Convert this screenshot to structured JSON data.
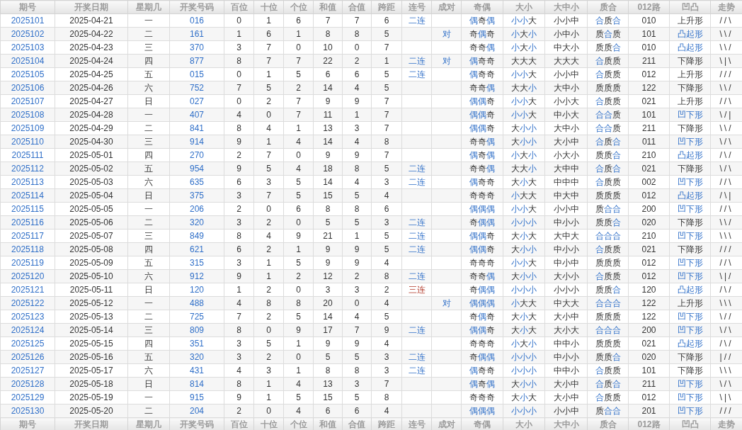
{
  "table": {
    "columns": [
      "期号",
      "开奖日期",
      "星期几",
      "开奖号码",
      "百位",
      "十位",
      "个位",
      "和值",
      "合值",
      "跨距",
      "连号",
      "成对",
      "奇偶",
      "大小",
      "大中小",
      "质合",
      "012路",
      "凹凸",
      "走势"
    ],
    "rows": [
      {
        "issue": "2025101",
        "date": "2025-04-21",
        "weekday": "一",
        "number": "016",
        "hundreds": "0",
        "tens": "1",
        "ones": "6",
        "sum": "7",
        "sum_tail": "7",
        "spread": "6",
        "consecutive": {
          "text": "二连",
          "kind": "double"
        },
        "odd_even": {
          "text": "偶奇偶",
          "highlight": [
            true,
            false,
            true
          ]
        },
        "big_small": {
          "text": "小小大",
          "highlight": [
            true,
            true,
            false
          ]
        },
        "size3": "小小中",
        "prime": {
          "text": "合质合",
          "highlight": [
            true,
            false,
            true
          ]
        },
        "route": "010",
        "shape": {
          "text": "上升形",
          "highlight": false
        },
        "trend": "//\\"
      },
      {
        "issue": "2025102",
        "date": "2025-04-22",
        "weekday": "二",
        "number": "161",
        "hundreds": "1",
        "tens": "6",
        "ones": "1",
        "sum": "8",
        "sum_tail": "8",
        "spread": "5",
        "pair": "对",
        "odd_even": {
          "text": "奇偶奇",
          "highlight": [
            false,
            true,
            false
          ]
        },
        "big_small": {
          "text": "小大小",
          "highlight": [
            true,
            false,
            true
          ]
        },
        "size3": "小中小",
        "prime": {
          "text": "质合质",
          "highlight": [
            false,
            true,
            false
          ]
        },
        "route": "101",
        "shape": {
          "text": "凸起形",
          "highlight": true
        },
        "trend": "\\\\/"
      },
      {
        "issue": "2025103",
        "date": "2025-04-23",
        "weekday": "三",
        "number": "370",
        "hundreds": "3",
        "tens": "7",
        "ones": "0",
        "sum": "10",
        "sum_tail": "0",
        "spread": "7",
        "odd_even": {
          "text": "奇奇偶",
          "highlight": [
            false,
            false,
            true
          ]
        },
        "big_small": {
          "text": "小大小",
          "highlight": [
            true,
            false,
            true
          ]
        },
        "size3": "中大小",
        "prime": {
          "text": "质质合",
          "highlight": [
            false,
            false,
            true
          ]
        },
        "route": "010",
        "shape": {
          "text": "凸起形",
          "highlight": true
        },
        "trend": "\\\\/"
      },
      {
        "issue": "2025104",
        "date": "2025-04-24",
        "weekday": "四",
        "number": "877",
        "hundreds": "8",
        "tens": "7",
        "ones": "7",
        "sum": "22",
        "sum_tail": "2",
        "spread": "1",
        "consecutive": {
          "text": "二连",
          "kind": "double"
        },
        "pair": "对",
        "odd_even": {
          "text": "偶奇奇",
          "highlight": [
            true,
            false,
            false
          ]
        },
        "big_small": {
          "text": "大大大",
          "highlight": [
            false,
            false,
            false
          ]
        },
        "size3": "大大大",
        "prime": {
          "text": "合质质",
          "highlight": [
            true,
            false,
            false
          ]
        },
        "route": "211",
        "shape": {
          "text": "下降形",
          "highlight": false
        },
        "trend": "\\|\\"
      },
      {
        "issue": "2025105",
        "date": "2025-04-25",
        "weekday": "五",
        "number": "015",
        "hundreds": "0",
        "tens": "1",
        "ones": "5",
        "sum": "6",
        "sum_tail": "6",
        "spread": "5",
        "consecutive": {
          "text": "二连",
          "kind": "double"
        },
        "odd_even": {
          "text": "偶奇奇",
          "highlight": [
            true,
            false,
            false
          ]
        },
        "big_small": {
          "text": "小小大",
          "highlight": [
            true,
            true,
            false
          ]
        },
        "size3": "小小中",
        "prime": {
          "text": "合质质",
          "highlight": [
            true,
            false,
            false
          ]
        },
        "route": "012",
        "shape": {
          "text": "上升形",
          "highlight": false
        },
        "trend": "///"
      },
      {
        "issue": "2025106",
        "date": "2025-04-26",
        "weekday": "六",
        "number": "752",
        "hundreds": "7",
        "tens": "5",
        "ones": "2",
        "sum": "14",
        "sum_tail": "4",
        "spread": "5",
        "odd_even": {
          "text": "奇奇偶",
          "highlight": [
            false,
            false,
            true
          ]
        },
        "big_small": {
          "text": "大大小",
          "highlight": [
            false,
            false,
            true
          ]
        },
        "size3": "大中小",
        "prime": {
          "text": "质质质",
          "highlight": [
            false,
            false,
            false
          ]
        },
        "route": "122",
        "shape": {
          "text": "下降形",
          "highlight": false
        },
        "trend": "\\\\/"
      },
      {
        "issue": "2025107",
        "date": "2025-04-27",
        "weekday": "日",
        "number": "027",
        "hundreds": "0",
        "tens": "2",
        "ones": "7",
        "sum": "9",
        "sum_tail": "9",
        "spread": "7",
        "odd_even": {
          "text": "偶偶奇",
          "highlight": [
            true,
            true,
            false
          ]
        },
        "big_small": {
          "text": "小小大",
          "highlight": [
            true,
            true,
            false
          ]
        },
        "size3": "小小大",
        "prime": {
          "text": "合质质",
          "highlight": [
            true,
            false,
            false
          ]
        },
        "route": "021",
        "shape": {
          "text": "上升形",
          "highlight": false
        },
        "trend": "//\\"
      },
      {
        "issue": "2025108",
        "date": "2025-04-28",
        "weekday": "一",
        "number": "407",
        "hundreds": "4",
        "tens": "0",
        "ones": "7",
        "sum": "11",
        "sum_tail": "1",
        "spread": "7",
        "odd_even": {
          "text": "偶偶奇",
          "highlight": [
            true,
            true,
            false
          ]
        },
        "big_small": {
          "text": "小小大",
          "highlight": [
            true,
            true,
            false
          ]
        },
        "size3": "中小大",
        "prime": {
          "text": "合合质",
          "highlight": [
            true,
            true,
            false
          ]
        },
        "route": "101",
        "shape": {
          "text": "凹下形",
          "highlight": true
        },
        "trend": "\\/|"
      },
      {
        "issue": "2025109",
        "date": "2025-04-29",
        "weekday": "二",
        "number": "841",
        "hundreds": "8",
        "tens": "4",
        "ones": "1",
        "sum": "13",
        "sum_tail": "3",
        "spread": "7",
        "odd_even": {
          "text": "偶偶奇",
          "highlight": [
            true,
            true,
            false
          ]
        },
        "big_small": {
          "text": "大小小",
          "highlight": [
            false,
            true,
            true
          ]
        },
        "size3": "大中小",
        "prime": {
          "text": "合合质",
          "highlight": [
            true,
            true,
            false
          ]
        },
        "route": "211",
        "shape": {
          "text": "下降形",
          "highlight": false
        },
        "trend": "\\\\/"
      },
      {
        "issue": "2025110",
        "date": "2025-04-30",
        "weekday": "三",
        "number": "914",
        "hundreds": "9",
        "tens": "1",
        "ones": "4",
        "sum": "14",
        "sum_tail": "4",
        "spread": "8",
        "odd_even": {
          "text": "奇奇偶",
          "highlight": [
            false,
            false,
            true
          ]
        },
        "big_small": {
          "text": "大小小",
          "highlight": [
            false,
            true,
            true
          ]
        },
        "size3": "大小中",
        "prime": {
          "text": "合质合",
          "highlight": [
            true,
            false,
            true
          ]
        },
        "route": "011",
        "shape": {
          "text": "凹下形",
          "highlight": true
        },
        "trend": "\\/\\"
      },
      {
        "issue": "2025111",
        "date": "2025-05-01",
        "weekday": "四",
        "number": "270",
        "hundreds": "2",
        "tens": "7",
        "ones": "0",
        "sum": "9",
        "sum_tail": "9",
        "spread": "7",
        "odd_even": {
          "text": "偶奇偶",
          "highlight": [
            true,
            false,
            true
          ]
        },
        "big_small": {
          "text": "小大小",
          "highlight": [
            true,
            false,
            true
          ]
        },
        "size3": "小大小",
        "prime": {
          "text": "质质合",
          "highlight": [
            false,
            false,
            true
          ]
        },
        "route": "210",
        "shape": {
          "text": "凸起形",
          "highlight": true
        },
        "trend": "/\\/"
      },
      {
        "issue": "2025112",
        "date": "2025-05-02",
        "weekday": "五",
        "number": "954",
        "hundreds": "9",
        "tens": "5",
        "ones": "4",
        "sum": "18",
        "sum_tail": "8",
        "spread": "5",
        "consecutive": {
          "text": "二连",
          "kind": "double"
        },
        "odd_even": {
          "text": "奇奇偶",
          "highlight": [
            false,
            false,
            true
          ]
        },
        "big_small": {
          "text": "大大小",
          "highlight": [
            false,
            false,
            true
          ]
        },
        "size3": "大中中",
        "prime": {
          "text": "合质合",
          "highlight": [
            true,
            false,
            true
          ]
        },
        "route": "021",
        "shape": {
          "text": "下降形",
          "highlight": false
        },
        "trend": "\\/\\"
      },
      {
        "issue": "2025113",
        "date": "2025-05-03",
        "weekday": "六",
        "number": "635",
        "hundreds": "6",
        "tens": "3",
        "ones": "5",
        "sum": "14",
        "sum_tail": "4",
        "spread": "3",
        "consecutive": {
          "text": "二连",
          "kind": "double"
        },
        "odd_even": {
          "text": "偶奇奇",
          "highlight": [
            true,
            false,
            false
          ]
        },
        "big_small": {
          "text": "大小大",
          "highlight": [
            false,
            true,
            false
          ]
        },
        "size3": "中中中",
        "prime": {
          "text": "合质质",
          "highlight": [
            true,
            false,
            false
          ]
        },
        "route": "002",
        "shape": {
          "text": "凹下形",
          "highlight": true
        },
        "trend": "//\\"
      },
      {
        "issue": "2025114",
        "date": "2025-05-04",
        "weekday": "日",
        "number": "375",
        "hundreds": "3",
        "tens": "7",
        "ones": "5",
        "sum": "15",
        "sum_tail": "5",
        "spread": "4",
        "odd_even": {
          "text": "奇奇奇",
          "highlight": [
            false,
            false,
            false
          ]
        },
        "big_small": {
          "text": "小大大",
          "highlight": [
            true,
            false,
            false
          ]
        },
        "size3": "中大中",
        "prime": {
          "text": "质质质",
          "highlight": [
            false,
            false,
            false
          ]
        },
        "route": "012",
        "shape": {
          "text": "凸起形",
          "highlight": true
        },
        "trend": "/\\|"
      },
      {
        "issue": "2025115",
        "date": "2025-05-05",
        "weekday": "一",
        "number": "206",
        "hundreds": "2",
        "tens": "0",
        "ones": "6",
        "sum": "8",
        "sum_tail": "8",
        "spread": "6",
        "odd_even": {
          "text": "偶偶偶",
          "highlight": [
            true,
            true,
            true
          ]
        },
        "big_small": {
          "text": "小小大",
          "highlight": [
            true,
            true,
            false
          ]
        },
        "size3": "小小中",
        "prime": {
          "text": "质合合",
          "highlight": [
            false,
            true,
            true
          ]
        },
        "route": "200",
        "shape": {
          "text": "凹下形",
          "highlight": true
        },
        "trend": "//\\"
      },
      {
        "issue": "2025116",
        "date": "2025-05-06",
        "weekday": "二",
        "number": "320",
        "hundreds": "3",
        "tens": "2",
        "ones": "0",
        "sum": "5",
        "sum_tail": "5",
        "spread": "3",
        "consecutive": {
          "text": "二连",
          "kind": "double"
        },
        "odd_even": {
          "text": "奇偶偶",
          "highlight": [
            false,
            true,
            true
          ]
        },
        "big_small": {
          "text": "小小小",
          "highlight": [
            true,
            true,
            true
          ]
        },
        "size3": "中小小",
        "prime": {
          "text": "质质合",
          "highlight": [
            false,
            false,
            true
          ]
        },
        "route": "020",
        "shape": {
          "text": "下降形",
          "highlight": false
        },
        "trend": "\\\\/"
      },
      {
        "issue": "2025117",
        "date": "2025-05-07",
        "weekday": "三",
        "number": "849",
        "hundreds": "8",
        "tens": "4",
        "ones": "9",
        "sum": "21",
        "sum_tail": "1",
        "spread": "5",
        "consecutive": {
          "text": "二连",
          "kind": "double"
        },
        "odd_even": {
          "text": "偶偶奇",
          "highlight": [
            true,
            true,
            false
          ]
        },
        "big_small": {
          "text": "大小大",
          "highlight": [
            false,
            true,
            false
          ]
        },
        "size3": "大中大",
        "prime": {
          "text": "合合合",
          "highlight": [
            true,
            true,
            true
          ]
        },
        "route": "210",
        "shape": {
          "text": "凹下形",
          "highlight": true
        },
        "trend": "\\\\\\"
      },
      {
        "issue": "2025118",
        "date": "2025-05-08",
        "weekday": "四",
        "number": "621",
        "hundreds": "6",
        "tens": "2",
        "ones": "1",
        "sum": "9",
        "sum_tail": "9",
        "spread": "5",
        "consecutive": {
          "text": "二连",
          "kind": "double"
        },
        "odd_even": {
          "text": "偶偶奇",
          "highlight": [
            true,
            true,
            false
          ]
        },
        "big_small": {
          "text": "大小小",
          "highlight": [
            false,
            true,
            true
          ]
        },
        "size3": "中小小",
        "prime": {
          "text": "合质质",
          "highlight": [
            true,
            false,
            false
          ]
        },
        "route": "021",
        "shape": {
          "text": "下降形",
          "highlight": false
        },
        "trend": "///"
      },
      {
        "issue": "2025119",
        "date": "2025-05-09",
        "weekday": "五",
        "number": "315",
        "hundreds": "3",
        "tens": "1",
        "ones": "5",
        "sum": "9",
        "sum_tail": "9",
        "spread": "4",
        "odd_even": {
          "text": "奇奇奇",
          "highlight": [
            false,
            false,
            false
          ]
        },
        "big_small": {
          "text": "小小大",
          "highlight": [
            true,
            true,
            false
          ]
        },
        "size3": "中小中",
        "prime": {
          "text": "质质质",
          "highlight": [
            false,
            false,
            false
          ]
        },
        "route": "012",
        "shape": {
          "text": "凹下形",
          "highlight": true
        },
        "trend": "//\\"
      },
      {
        "issue": "2025120",
        "date": "2025-05-10",
        "weekday": "六",
        "number": "912",
        "hundreds": "9",
        "tens": "1",
        "ones": "2",
        "sum": "12",
        "sum_tail": "2",
        "spread": "8",
        "consecutive": {
          "text": "二连",
          "kind": "double"
        },
        "odd_even": {
          "text": "奇奇偶",
          "highlight": [
            false,
            false,
            true
          ]
        },
        "big_small": {
          "text": "大小小",
          "highlight": [
            false,
            true,
            true
          ]
        },
        "size3": "大小小",
        "prime": {
          "text": "合质质",
          "highlight": [
            true,
            false,
            false
          ]
        },
        "route": "012",
        "shape": {
          "text": "凹下形",
          "highlight": true
        },
        "trend": "\\|/"
      },
      {
        "issue": "2025121",
        "date": "2025-05-11",
        "weekday": "日",
        "number": "120",
        "hundreds": "1",
        "tens": "2",
        "ones": "0",
        "sum": "3",
        "sum_tail": "3",
        "spread": "2",
        "consecutive": {
          "text": "三连",
          "kind": "triple"
        },
        "odd_even": {
          "text": "奇偶偶",
          "highlight": [
            false,
            true,
            true
          ]
        },
        "big_small": {
          "text": "小小小",
          "highlight": [
            true,
            true,
            true
          ]
        },
        "size3": "小小小",
        "prime": {
          "text": "质质合",
          "highlight": [
            false,
            false,
            true
          ]
        },
        "route": "120",
        "shape": {
          "text": "凸起形",
          "highlight": true
        },
        "trend": "/\\/"
      },
      {
        "issue": "2025122",
        "date": "2025-05-12",
        "weekday": "一",
        "number": "488",
        "hundreds": "4",
        "tens": "8",
        "ones": "8",
        "sum": "20",
        "sum_tail": "0",
        "spread": "4",
        "pair": "对",
        "odd_even": {
          "text": "偶偶偶",
          "highlight": [
            true,
            true,
            true
          ]
        },
        "big_small": {
          "text": "小大大",
          "highlight": [
            true,
            false,
            false
          ]
        },
        "size3": "中大大",
        "prime": {
          "text": "合合合",
          "highlight": [
            true,
            true,
            true
          ]
        },
        "route": "122",
        "shape": {
          "text": "上升形",
          "highlight": false
        },
        "trend": "\\\\\\"
      },
      {
        "issue": "2025123",
        "date": "2025-05-13",
        "weekday": "二",
        "number": "725",
        "hundreds": "7",
        "tens": "2",
        "ones": "5",
        "sum": "14",
        "sum_tail": "4",
        "spread": "5",
        "odd_even": {
          "text": "奇偶奇",
          "highlight": [
            false,
            true,
            false
          ]
        },
        "big_small": {
          "text": "大小大",
          "highlight": [
            false,
            true,
            false
          ]
        },
        "size3": "大小中",
        "prime": {
          "text": "质质质",
          "highlight": [
            false,
            false,
            false
          ]
        },
        "route": "122",
        "shape": {
          "text": "凹下形",
          "highlight": true
        },
        "trend": "\\//"
      },
      {
        "issue": "2025124",
        "date": "2025-05-14",
        "weekday": "三",
        "number": "809",
        "hundreds": "8",
        "tens": "0",
        "ones": "9",
        "sum": "17",
        "sum_tail": "7",
        "spread": "9",
        "consecutive": {
          "text": "二连",
          "kind": "double"
        },
        "odd_even": {
          "text": "偶偶奇",
          "highlight": [
            true,
            true,
            false
          ]
        },
        "big_small": {
          "text": "大小大",
          "highlight": [
            false,
            true,
            false
          ]
        },
        "size3": "大小大",
        "prime": {
          "text": "合合合",
          "highlight": [
            true,
            true,
            true
          ]
        },
        "route": "200",
        "shape": {
          "text": "凹下形",
          "highlight": true
        },
        "trend": "\\/\\"
      },
      {
        "issue": "2025125",
        "date": "2025-05-15",
        "weekday": "四",
        "number": "351",
        "hundreds": "3",
        "tens": "5",
        "ones": "1",
        "sum": "9",
        "sum_tail": "9",
        "spread": "4",
        "odd_even": {
          "text": "奇奇奇",
          "highlight": [
            false,
            false,
            false
          ]
        },
        "big_small": {
          "text": "小大小",
          "highlight": [
            true,
            false,
            true
          ]
        },
        "size3": "中中小",
        "prime": {
          "text": "质质质",
          "highlight": [
            false,
            false,
            false
          ]
        },
        "route": "021",
        "shape": {
          "text": "凸起形",
          "highlight": true
        },
        "trend": "/\\/"
      },
      {
        "issue": "2025126",
        "date": "2025-05-16",
        "weekday": "五",
        "number": "320",
        "hundreds": "3",
        "tens": "2",
        "ones": "0",
        "sum": "5",
        "sum_tail": "5",
        "spread": "3",
        "consecutive": {
          "text": "二连",
          "kind": "double"
        },
        "odd_even": {
          "text": "奇偶偶",
          "highlight": [
            false,
            true,
            true
          ]
        },
        "big_small": {
          "text": "小小小",
          "highlight": [
            true,
            true,
            true
          ]
        },
        "size3": "中小小",
        "prime": {
          "text": "质质合",
          "highlight": [
            false,
            false,
            true
          ]
        },
        "route": "020",
        "shape": {
          "text": "下降形",
          "highlight": false
        },
        "trend": "|//"
      },
      {
        "issue": "2025127",
        "date": "2025-05-17",
        "weekday": "六",
        "number": "431",
        "hundreds": "4",
        "tens": "3",
        "ones": "1",
        "sum": "8",
        "sum_tail": "8",
        "spread": "3",
        "consecutive": {
          "text": "二连",
          "kind": "double"
        },
        "odd_even": {
          "text": "偶奇奇",
          "highlight": [
            true,
            false,
            false
          ]
        },
        "big_small": {
          "text": "小小小",
          "highlight": [
            true,
            true,
            true
          ]
        },
        "size3": "中中小",
        "prime": {
          "text": "合质质",
          "highlight": [
            true,
            false,
            false
          ]
        },
        "route": "101",
        "shape": {
          "text": "下降形",
          "highlight": false
        },
        "trend": "\\\\\\"
      },
      {
        "issue": "2025128",
        "date": "2025-05-18",
        "weekday": "日",
        "number": "814",
        "hundreds": "8",
        "tens": "1",
        "ones": "4",
        "sum": "13",
        "sum_tail": "3",
        "spread": "7",
        "odd_even": {
          "text": "偶奇偶",
          "highlight": [
            true,
            false,
            true
          ]
        },
        "big_small": {
          "text": "大小小",
          "highlight": [
            false,
            true,
            true
          ]
        },
        "size3": "大小中",
        "prime": {
          "text": "合质合",
          "highlight": [
            true,
            false,
            true
          ]
        },
        "route": "211",
        "shape": {
          "text": "凹下形",
          "highlight": true
        },
        "trend": "\\/\\"
      },
      {
        "issue": "2025129",
        "date": "2025-05-19",
        "weekday": "一",
        "number": "915",
        "hundreds": "9",
        "tens": "1",
        "ones": "5",
        "sum": "15",
        "sum_tail": "5",
        "spread": "8",
        "odd_even": {
          "text": "奇奇奇",
          "highlight": [
            false,
            false,
            false
          ]
        },
        "big_small": {
          "text": "大小大",
          "highlight": [
            false,
            true,
            false
          ]
        },
        "size3": "大小中",
        "prime": {
          "text": "合质质",
          "highlight": [
            true,
            false,
            false
          ]
        },
        "route": "012",
        "shape": {
          "text": "凹下形",
          "highlight": true
        },
        "trend": "\\|\\"
      },
      {
        "issue": "2025130",
        "date": "2025-05-20",
        "weekday": "二",
        "number": "204",
        "hundreds": "2",
        "tens": "0",
        "ones": "4",
        "sum": "6",
        "sum_tail": "6",
        "spread": "4",
        "odd_even": {
          "text": "偶偶偶",
          "highlight": [
            true,
            true,
            true
          ]
        },
        "big_small": {
          "text": "小小小",
          "highlight": [
            true,
            true,
            true
          ]
        },
        "size3": "小小中",
        "prime": {
          "text": "质合合",
          "highlight": [
            false,
            true,
            true
          ]
        },
        "route": "201",
        "shape": {
          "text": "凹下形",
          "highlight": true
        },
        "trend": "///"
      }
    ],
    "footer_columns": [
      "期号",
      "开奖日期",
      "星期几",
      "开奖号码",
      "百位",
      "十位",
      "个位",
      "和值",
      "合值",
      "跨距",
      "连号",
      "成对",
      "奇偶",
      "大小",
      "大中小",
      "质合",
      "012路",
      "凹凸",
      "走势"
    ]
  }
}
